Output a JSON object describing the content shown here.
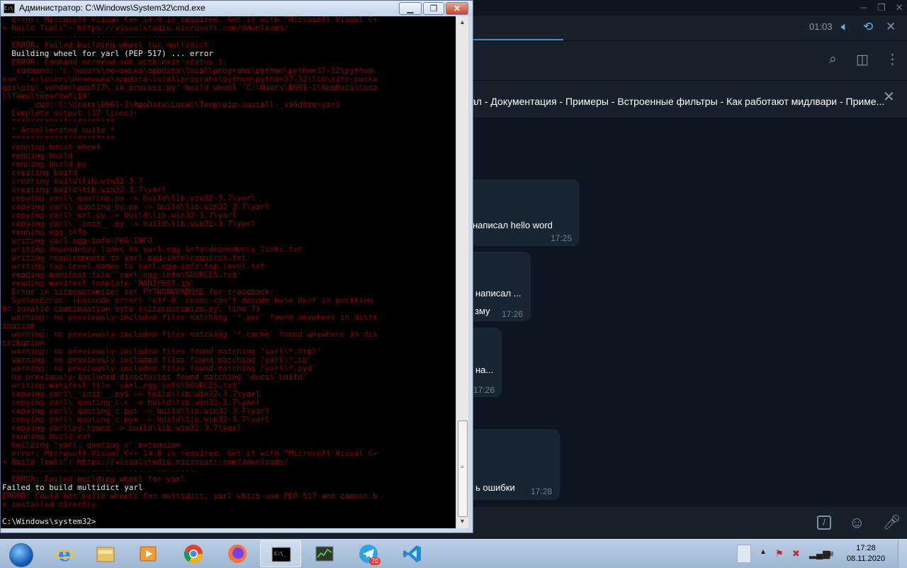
{
  "telegram": {
    "player_time": "01:03",
    "pinned_text": "ал - Документация - Примеры - Встроенные фильтры - Как работают мидлвари - Приме...",
    "messages": [
      {
        "text": "написал hello word",
        "time": "17:25"
      },
      {
        "text": "написал ...",
        "text2": "зму",
        "time": "17:26"
      },
      {
        "text": "на...",
        "time": "17:26"
      },
      {
        "text": "ь ошибки",
        "time": "17:28"
      }
    ],
    "icons": {
      "minimize": "window-minimize-icon",
      "maximize": "window-maximize-icon",
      "close": "window-close-icon",
      "volume": "volume-icon",
      "repeat": "repeat-icon",
      "player_close": "close-icon",
      "search": "search-icon",
      "sidebar": "sidebar-toggle-icon",
      "menu": "more-vertical-icon",
      "commands": "slash-commands-icon",
      "emoji": "emoji-icon",
      "mic": "microphone-icon"
    }
  },
  "cmd": {
    "title": "Администратор: C:\\Windows\\System32\\cmd.exe",
    "icon_text": "C:\\",
    "buttons": {
      "minimize": "▁",
      "maximize": "❐",
      "close": "✕"
    },
    "lines": [
      {
        "c": "r",
        "t": "  error: Microsoft Visual C++ 14.0 is required. Get it with \"Microsoft Visual C+"
      },
      {
        "c": "r",
        "t": "+ Build Tools\": https://visualstudio.microsoft.com/downloads/"
      },
      {
        "c": "r",
        "t": "  ----------------------------------------"
      },
      {
        "c": "r",
        "t": "  ERROR: Failed building wheel for multidict"
      },
      {
        "c": "w",
        "t": "  Building wheel for yarl (PEP 517) ... error"
      },
      {
        "c": "r",
        "t": "  ERROR: Command errored out with exit status 1:"
      },
      {
        "c": "r",
        "t": "   command: 'c:\\users\\печенька\\appdata\\local\\programs\\python\\python37-32\\python."
      },
      {
        "c": "r",
        "t": "exe' 'c:\\users\\печенька\\appdata\\local\\programs\\python\\python37-32\\lib\\site-packa"
      },
      {
        "c": "r",
        "t": "ges\\pip\\_vendor\\pep517\\_in_process.py' build_wheel 'C:\\Users\\B661~1\\AppData\\Loca"
      },
      {
        "c": "r",
        "t": "l\\Temp\\tmpof0wfi19'"
      },
      {
        "c": "r",
        "t": "       cwd: C:\\Users\\B661~1\\AppData\\Local\\Temp\\pip-install-_vi6d0te\\yarl"
      },
      {
        "c": "r",
        "t": "  Complete output (37 lines):"
      },
      {
        "c": "r",
        "t": "  **********************"
      },
      {
        "c": "r",
        "t": "  * Accellerated build *"
      },
      {
        "c": "r",
        "t": "  **********************"
      },
      {
        "c": "r",
        "t": "  running bdist_wheel"
      },
      {
        "c": "r",
        "t": "  running build"
      },
      {
        "c": "r",
        "t": "  running build_py"
      },
      {
        "c": "r",
        "t": "  creating build"
      },
      {
        "c": "r",
        "t": "  creating build\\lib.win32-3.7"
      },
      {
        "c": "r",
        "t": "  creating build\\lib.win32-3.7\\yarl"
      },
      {
        "c": "r",
        "t": "  copying yarl\\_quoting.py -> build\\lib.win32-3.7\\yarl"
      },
      {
        "c": "r",
        "t": "  copying yarl\\_quoting_py.py -> build\\lib.win32-3.7\\yarl"
      },
      {
        "c": "r",
        "t": "  copying yarl\\_url.py -> build\\lib.win32-3.7\\yarl"
      },
      {
        "c": "r",
        "t": "  copying yarl\\__init__.py -> build\\lib.win32-3.7\\yarl"
      },
      {
        "c": "r",
        "t": "  running egg_info"
      },
      {
        "c": "r",
        "t": "  writing yarl.egg-info\\PKG-INFO"
      },
      {
        "c": "r",
        "t": "  writing dependency_links to yarl.egg-info\\dependency_links.txt"
      },
      {
        "c": "r",
        "t": "  writing requirements to yarl.egg-info\\requires.txt"
      },
      {
        "c": "r",
        "t": "  writing top-level names to yarl.egg-info\\top_level.txt"
      },
      {
        "c": "r",
        "t": "  reading manifest file 'yarl.egg-info\\SOURCES.txt'"
      },
      {
        "c": "r",
        "t": "  reading manifest template 'MANIFEST.in'"
      },
      {
        "c": "r",
        "t": "  Error in sitecustomize; set PYTHONVERBOSE for traceback:"
      },
      {
        "c": "r",
        "t": "  SyntaxError: (unicode error) 'utf-8' codec can't decode byte 0xef in position"
      },
      {
        "c": "r",
        "t": "0: invalid continuation byte (sitecustomize.py, line 7)"
      },
      {
        "c": "r",
        "t": "  warning: no previously-included files matching '*.pyc' found anywhere in distr"
      },
      {
        "c": "r",
        "t": "ibution"
      },
      {
        "c": "r",
        "t": "  warning: no previously-included files matching '*.cache' found anywhere in dis"
      },
      {
        "c": "r",
        "t": "tribution"
      },
      {
        "c": "r",
        "t": "  warning: no previously-included files found matching 'yarl\\*.html'"
      },
      {
        "c": "r",
        "t": "  warning: no previously-included files found matching 'yarl\\*.so'"
      },
      {
        "c": "r",
        "t": "  warning: no previously-included files found matching 'yarl\\*.pyd'"
      },
      {
        "c": "r",
        "t": "  no previously-included directories found matching 'docs\\_build'"
      },
      {
        "c": "r",
        "t": "  writing manifest file 'yarl.egg-info\\SOURCES.txt'"
      },
      {
        "c": "r",
        "t": "  copying yarl\\__init__.pyi -> build\\lib.win32-3.7\\yarl"
      },
      {
        "c": "r",
        "t": "  copying yarl\\_quoting_c.c -> build\\lib.win32-3.7\\yarl"
      },
      {
        "c": "r",
        "t": "  copying yarl\\_quoting_c.pyi -> build\\lib.win32-3.7\\yarl"
      },
      {
        "c": "r",
        "t": "  copying yarl\\_quoting_c.pyx -> build\\lib.win32-3.7\\yarl"
      },
      {
        "c": "r",
        "t": "  copying yarl\\py.typed -> build\\lib.win32-3.7\\yarl"
      },
      {
        "c": "r",
        "t": "  running build_ext"
      },
      {
        "c": "r",
        "t": "  building 'yarl._quoting_c' extension"
      },
      {
        "c": "r",
        "t": "  error: Microsoft Visual C++ 14.0 is required. Get it with \"Microsoft Visual C+"
      },
      {
        "c": "r",
        "t": "+ Build Tools\": https://visualstudio.microsoft.com/downloads/"
      },
      {
        "c": "r",
        "t": "  ----------------------------------------"
      },
      {
        "c": "r",
        "t": "  ERROR: Failed building wheel for yarl"
      },
      {
        "c": "w",
        "t": "Failed to build multidict yarl"
      },
      {
        "c": "r",
        "t": "ERROR: Could not build wheels for multidict, yarl which use PEP 517 and cannot b"
      },
      {
        "c": "r",
        "t": "e installed directly"
      },
      {
        "c": "w",
        "t": ""
      },
      {
        "c": "w",
        "t": "C:\\Windows\\system32>"
      }
    ]
  },
  "taskbar": {
    "telegram_badge": "70",
    "clock_time": "17:28",
    "clock_date": "08.11.2020",
    "apps": [
      "start-button",
      "internet-explorer-icon",
      "file-explorer-icon",
      "media-player-icon",
      "chrome-icon",
      "firefox-icon",
      "cmd-icon",
      "task-manager-icon",
      "telegram-icon",
      "vscode-icon"
    ]
  }
}
